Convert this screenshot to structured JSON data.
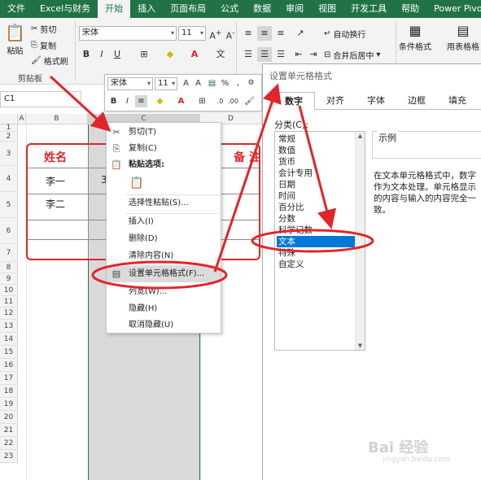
{
  "ribbon": {
    "tabs": [
      "文件",
      "Excel与财务",
      "开始",
      "插入",
      "页面布局",
      "公式",
      "数据",
      "审阅",
      "视图",
      "开发工具",
      "帮助",
      "Power Pivot"
    ],
    "active_tab": "开始",
    "clipboard": {
      "paste": "粘贴",
      "cut": "剪切",
      "copy": "复制",
      "format_painter": "格式刷",
      "group_label": "剪贴板"
    },
    "font": {
      "name": "宋体",
      "size": "11"
    },
    "alignment": {
      "wrap_text": "自动换行",
      "merge_center": "合并后居中"
    },
    "styles": {
      "conditional_format": "条件格式",
      "table_format": "套用表格格式"
    }
  },
  "name_box": "C1",
  "sheet": {
    "columns": [
      "A",
      "B",
      "C",
      "D"
    ],
    "rows": [
      "1",
      "2",
      "3",
      "4",
      "5",
      "6",
      "7",
      "8",
      "9",
      "10",
      "11",
      "12",
      "13",
      "14",
      "15",
      "16",
      "17",
      "18",
      "19",
      "20",
      "21",
      "22",
      "23"
    ],
    "table": {
      "header_name": "姓名",
      "header_note": "备 注",
      "row1_name": "李一",
      "row1_partial": "3",
      "row2_name": "李二"
    }
  },
  "mini_toolbar": {
    "font": "宋体",
    "size": "11"
  },
  "context_menu": {
    "items": [
      {
        "label": "剪切(T)",
        "icon": "scissors-icon"
      },
      {
        "label": "复制(C)",
        "icon": "copy-icon"
      },
      {
        "label": "粘贴选项:",
        "icon": "paste-icon"
      },
      {
        "label": "选择性粘贴(S)...",
        "icon": ""
      },
      {
        "label": "插入(I)",
        "icon": ""
      },
      {
        "label": "删除(D)",
        "icon": ""
      },
      {
        "label": "清除内容(N)",
        "icon": ""
      },
      {
        "label": "设置单元格格式(F)...",
        "icon": "format-cells-icon"
      },
      {
        "label": "列宽(W)...",
        "icon": ""
      },
      {
        "label": "隐藏(H)",
        "icon": ""
      },
      {
        "label": "取消隐藏(U)",
        "icon": ""
      }
    ]
  },
  "dialog": {
    "title": "设置单元格格式",
    "tabs": [
      "数字",
      "对齐",
      "字体",
      "边框",
      "填充"
    ],
    "active_tab": "数字",
    "category_label": "分类(C):",
    "categories": [
      "常规",
      "数值",
      "货币",
      "会计专用",
      "日期",
      "时间",
      "百分比",
      "分数",
      "科学记数",
      "文本",
      "特殊",
      "自定义"
    ],
    "selected_category": "文本",
    "sample_label": "示例",
    "description": "在文本单元格格式中，数字作为文本处理。单元格显示的内容与输入的内容完全一致。"
  },
  "watermark": {
    "text": "Bai 经验",
    "sub": "jingyan.baidu.com"
  },
  "colors": {
    "ribbon_green": "#217346",
    "annotation_red": "#e0262a",
    "selection_blue": "#0078d7"
  }
}
